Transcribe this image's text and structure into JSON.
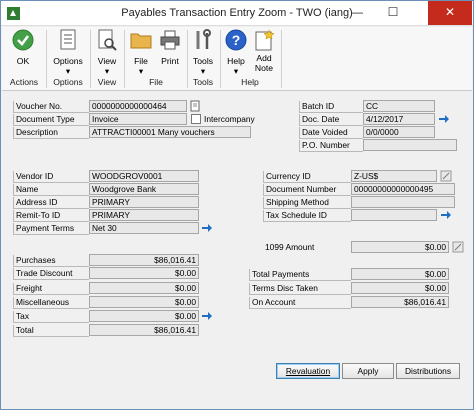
{
  "window": {
    "title": "Payables Transaction Entry Zoom  -  TWO (iang)",
    "minimize": "—",
    "maximize": "☐",
    "close": "✕"
  },
  "ribbon": {
    "buttons": {
      "ok": "OK",
      "options": "Options",
      "view": "View",
      "file": "File",
      "print": "Print",
      "tools": "Tools",
      "help": "Help",
      "add_note_1": "Add",
      "add_note_2": "Note"
    },
    "groups": {
      "actions": "Actions",
      "options": "Options",
      "view": "View",
      "file": "File",
      "tools": "Tools",
      "help": "Help"
    }
  },
  "header": {
    "voucher_no_label": "Voucher No.",
    "voucher_no": "0000000000000464",
    "document_type_label": "Document Type",
    "document_type": "Invoice",
    "intercompany_label": "Intercompany",
    "description_label": "Description",
    "description": "ATTRACTI00001 Many vouchers",
    "batch_id_label": "Batch ID",
    "batch_id": "CC",
    "doc_date_label": "Doc. Date",
    "doc_date": "4/12/2017",
    "date_voided_label": "Date Voided",
    "date_voided": "0/0/0000",
    "po_number_label": "P.O. Number",
    "po_number": ""
  },
  "vendor": {
    "vendor_id_label": "Vendor ID",
    "vendor_id": "WOODGROV0001",
    "name_label": "Name",
    "name": "Woodgrove Bank",
    "address_id_label": "Address ID",
    "address_id": "PRIMARY",
    "remit_to_label": "Remit-To ID",
    "remit_to": "PRIMARY",
    "payment_terms_label": "Payment Terms",
    "payment_terms": "Net 30",
    "currency_id_label": "Currency ID",
    "currency_id": "Z-US$",
    "document_number_label": "Document Number",
    "document_number": "00000000000000495",
    "shipping_method_label": "Shipping Method",
    "shipping_method": "",
    "tax_schedule_label": "Tax Schedule ID",
    "tax_schedule": "",
    "amount_1099_label": "1099 Amount",
    "amount_1099": "$0.00"
  },
  "amounts": {
    "purchases_label": "Purchases",
    "purchases": "$86,016.41",
    "trade_discount_label": "Trade Discount",
    "trade_discount": "$0.00",
    "freight_label": "Freight",
    "freight": "$0.00",
    "misc_label": "Miscellaneous",
    "misc": "$0.00",
    "tax_label": "Tax",
    "tax": "$0.00",
    "total_label": "Total",
    "total": "$86,016.41",
    "total_payments_label": "Total Payments",
    "total_payments": "$0.00",
    "terms_disc_label": "Terms Disc Taken",
    "terms_disc": "$0.00",
    "on_account_label": "On Account",
    "on_account": "$86,016.41"
  },
  "footer": {
    "revaluation": "Revaluation",
    "apply": "Apply",
    "distributions": "Distributions"
  },
  "colors": {
    "arrow_blue": "#1f6fc5",
    "close_red": "#c42b1c",
    "ok_green": "#4caf50",
    "help_blue": "#2a62c9"
  }
}
